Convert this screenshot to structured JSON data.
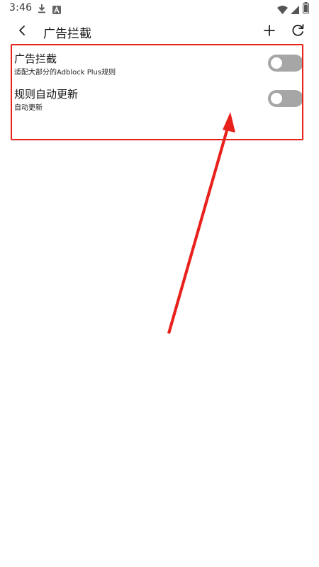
{
  "status_bar": {
    "time": "3:46",
    "left_icons": [
      "download-icon",
      "app-a-icon"
    ],
    "right_icons": [
      "wifi-icon",
      "signal-icon",
      "battery-icon"
    ]
  },
  "app_bar": {
    "title": "广告拦截",
    "back_icon": "back-arrow-icon",
    "add_icon": "plus-icon",
    "refresh_icon": "refresh-icon"
  },
  "settings": {
    "items": [
      {
        "title": "广告拦截",
        "subtitle": "适配大部分的Adblock Plus规则",
        "enabled": false
      },
      {
        "title": "规则自动更新",
        "subtitle": "自动更新",
        "enabled": false
      }
    ]
  },
  "colors": {
    "annotation_red": "#e8211b",
    "toggle_off_track": "#a6a6a6",
    "toggle_knob": "#ffffff",
    "text_primary": "#111111"
  }
}
